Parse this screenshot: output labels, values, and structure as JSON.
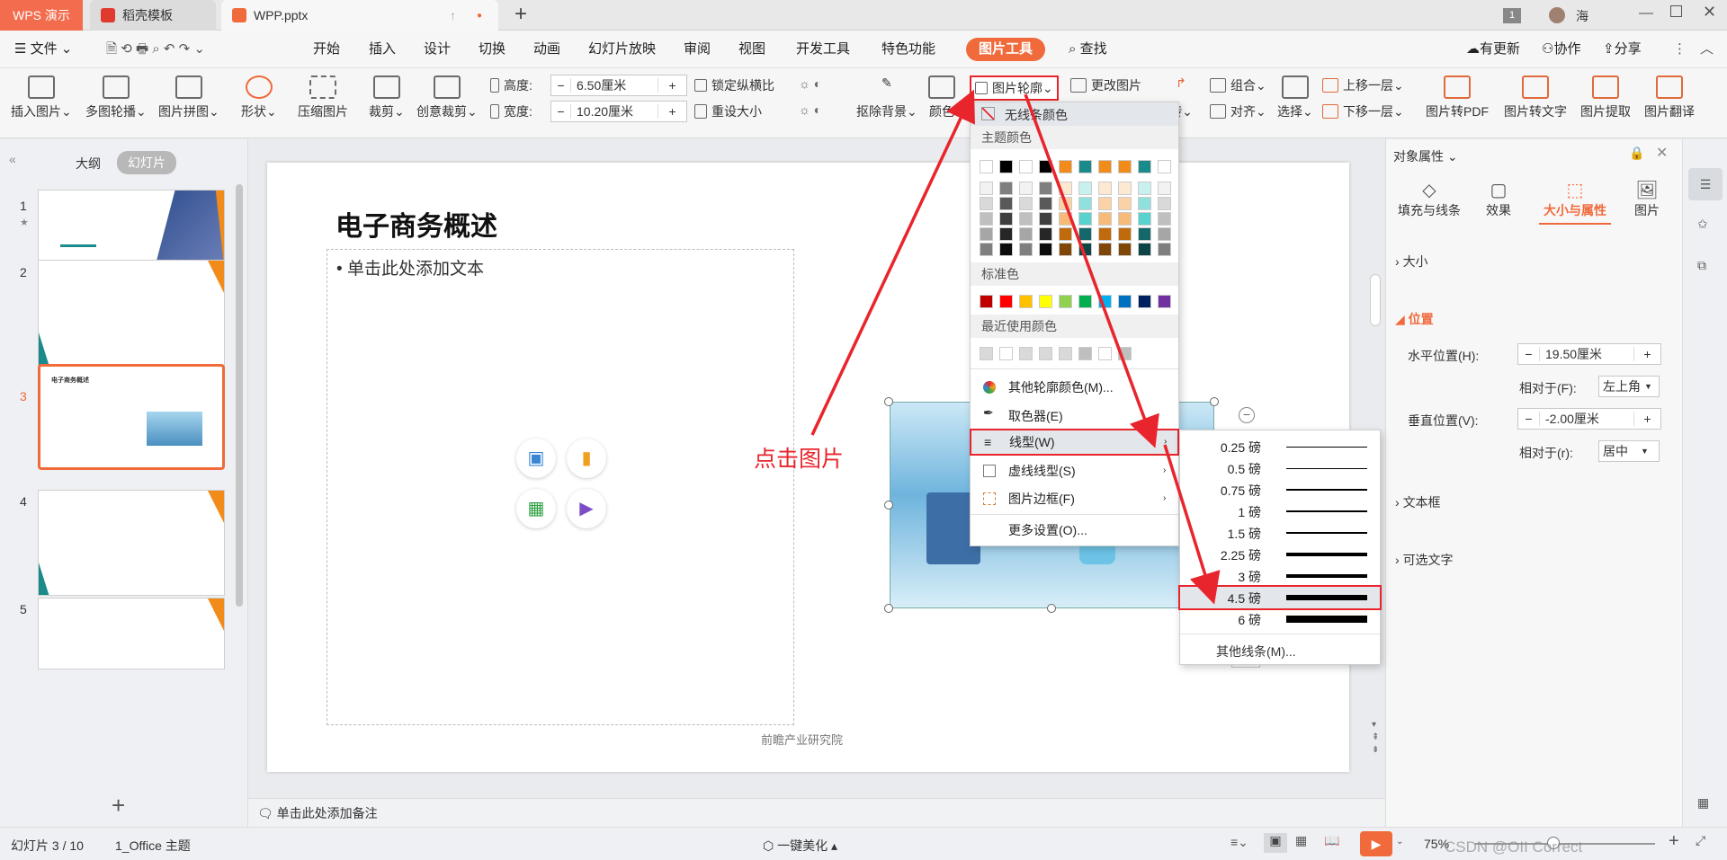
{
  "titlebar": {
    "app_tab": "WPS 演示",
    "template_tab": "稻壳模板",
    "doc_tab": "WPP.pptx",
    "new_tab": "+",
    "badge": "1",
    "user": "海"
  },
  "menubar": {
    "file": "文件",
    "items": [
      "开始",
      "插入",
      "设计",
      "切换",
      "动画",
      "幻灯片放映",
      "审阅",
      "视图",
      "开发工具",
      "特色功能"
    ],
    "active_tool": "图片工具",
    "search": "查找",
    "update": "有更新",
    "collab": "协作",
    "share": "分享"
  },
  "ribbon": {
    "insert_pic": "插入图片",
    "multi_carousel": "多图轮播",
    "pic_collage": "图片拼图",
    "shape": "形状",
    "compress": "压缩图片",
    "crop": "裁剪",
    "creative_crop": "创意裁剪",
    "height_label": "高度:",
    "height_value": "6.50厘米",
    "width_label": "宽度:",
    "width_value": "10.20厘米",
    "lock_ratio": "锁定纵横比",
    "reset_size": "重设大小",
    "remove_bg": "抠除背景",
    "color": "颜色",
    "pic_outline": "图片轮廓",
    "change_pic": "更改图片",
    "rotate_short": "转",
    "group": "组合",
    "align": "对齐",
    "select": "选择",
    "bring_forward": "上移一层",
    "send_backward": "下移一层",
    "to_pdf": "图片转PDF",
    "to_text": "图片转文字",
    "extract": "图片提取",
    "translate": "图片翻译",
    "minus": "−",
    "plus": "+"
  },
  "leftpanel": {
    "tab_outline": "大纲",
    "tab_slides": "幻灯片",
    "slide_numbers": [
      "1",
      "2",
      "3",
      "4",
      "5"
    ],
    "add": "+"
  },
  "slide": {
    "title": "电子商务概述",
    "bullet": "单击此处添加文本",
    "footer": "前瞻产业研究院",
    "annotation": "点击图片",
    "thumb3_title": "电子商务概述"
  },
  "dropdown": {
    "no_outline": "无线条颜色",
    "theme_colors": "主题颜色",
    "standard_colors": "标准色",
    "recent_colors": "最近使用颜色",
    "more_colors": "其他轮廓颜色(M)...",
    "eyedropper": "取色器(E)",
    "line_style": "线型(W)",
    "dash_style": "虚线线型(S)",
    "pic_border": "图片边框(F)",
    "more_settings": "更多设置(O)...",
    "theme_top": [
      "#ffffff",
      "#000000",
      "#ffffff",
      "#000000",
      "#f18c1b",
      "#1b8a8a",
      "#f18c1b",
      "#f18c1b",
      "#1b8a8a",
      "#ffffff"
    ],
    "theme_shades": [
      [
        "#f2f2f2",
        "#7f7f7f",
        "#f2f2f2",
        "#7f7f7f",
        "#fde8d2",
        "#c7f0ee",
        "#fde8d2",
        "#fde8d2",
        "#c7f0ee",
        "#f2f2f2"
      ],
      [
        "#d9d9d9",
        "#595959",
        "#d9d9d9",
        "#595959",
        "#fbd1a6",
        "#90e1dd",
        "#fbd1a6",
        "#fbd1a6",
        "#90e1dd",
        "#d9d9d9"
      ],
      [
        "#bfbfbf",
        "#3f3f3f",
        "#bfbfbf",
        "#3f3f3f",
        "#f8ba79",
        "#58d2cc",
        "#f8ba79",
        "#f8ba79",
        "#58d2cc",
        "#bfbfbf"
      ],
      [
        "#a6a6a6",
        "#262626",
        "#a6a6a6",
        "#262626",
        "#c06a0c",
        "#14676a",
        "#c06a0c",
        "#c06a0c",
        "#14676a",
        "#a6a6a6"
      ],
      [
        "#7f7f7f",
        "#0c0c0c",
        "#7f7f7f",
        "#0c0c0c",
        "#804608",
        "#0d4547",
        "#804608",
        "#804608",
        "#0d4547",
        "#7f7f7f"
      ]
    ],
    "standard": [
      "#c00000",
      "#ff0000",
      "#ffc000",
      "#ffff00",
      "#92d050",
      "#00b050",
      "#00b0f0",
      "#0070c0",
      "#002060",
      "#7030a0"
    ],
    "recent": [
      "#d9d9d9",
      "#ffffff",
      "#d9d9d9",
      "#d9d9d9",
      "#d9d9d9",
      "#bfbfbf",
      "#ffffff",
      "#bfbfbf"
    ]
  },
  "submenu": {
    "weights": [
      "0.25 磅",
      "0.5 磅",
      "0.75 磅",
      "1 磅",
      "1.5 磅",
      "2.25 磅",
      "3 磅",
      "4.5 磅",
      "6 磅"
    ],
    "thickness": [
      1,
      1,
      1.5,
      2,
      2.5,
      3.5,
      4,
      6,
      8
    ],
    "selected": "4.5 磅",
    "more_lines": "其他线条(M)..."
  },
  "rightpanel": {
    "header": "对象属性",
    "tabs": [
      "填充与线条",
      "效果",
      "大小与属性",
      "图片"
    ],
    "size": "大小",
    "position": "位置",
    "h_pos_label": "水平位置(H):",
    "h_pos_value": "19.50厘米",
    "relative_label": "相对于(F):",
    "relative_value": "左上角",
    "v_pos_label": "垂直位置(V):",
    "v_pos_value": "-2.00厘米",
    "relative_r_label": "相对于(r):",
    "relative_r_value": "居中",
    "textbox": "文本框",
    "alt_text": "可选文字"
  },
  "statusbar": {
    "slide_info": "幻灯片 3 / 10",
    "theme": "1_Office 主题",
    "notes": "单击此处添加备注",
    "beautify": "一键美化",
    "zoom": "75%",
    "watermark": "CSDN @OII Correct"
  },
  "colors": {
    "accent": "#f06a3b",
    "wps_tab": "#f36c4e",
    "annotation_red": "#e8252c",
    "teal": "#1b8a8a",
    "orange": "#f18c1b"
  }
}
